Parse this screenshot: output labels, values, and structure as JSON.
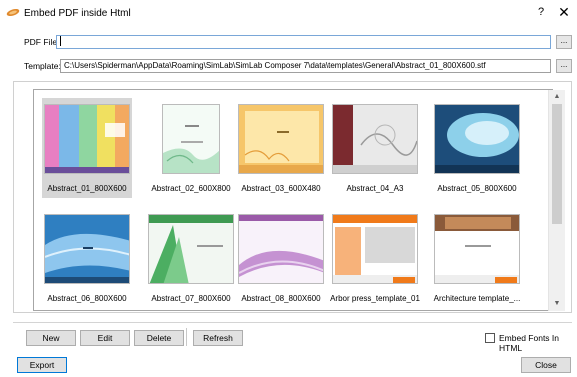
{
  "window": {
    "title": "Embed PDF inside Html",
    "help_label": "?",
    "close_label": "✕"
  },
  "pdf_file": {
    "label": "PDF File:",
    "value": "",
    "browse_label": "..."
  },
  "template": {
    "label": "Template:",
    "value": "C:\\Users\\Spiderman\\AppData\\Roaming\\SimLab\\SimLab Composer 7\\data\\templates\\General\\Abstract_01_800X600.stf",
    "browse_label": "..."
  },
  "gallery": {
    "selected_index": 0,
    "items": [
      {
        "label": "Abstract_01_800X600"
      },
      {
        "label": "Abstract_02_600X800"
      },
      {
        "label": "Abstract_03_600X480"
      },
      {
        "label": "Abstract_04_A3"
      },
      {
        "label": "Abstract_05_800X600"
      },
      {
        "label": "Abstract_06_800X600"
      },
      {
        "label": "Abstract_07_800X600"
      },
      {
        "label": "Abstract_08_800X600"
      },
      {
        "label": "Arbor press_template_01"
      },
      {
        "label": "Architecture template_..."
      }
    ]
  },
  "toolbar": {
    "new_label": "New",
    "edit_label": "Edit",
    "delete_label": "Delete",
    "refresh_label": "Refresh"
  },
  "embed_fonts": {
    "label": "Embed Fonts In HTML",
    "checked": false
  },
  "footer": {
    "export_label": "Export",
    "close_label": "Close"
  }
}
